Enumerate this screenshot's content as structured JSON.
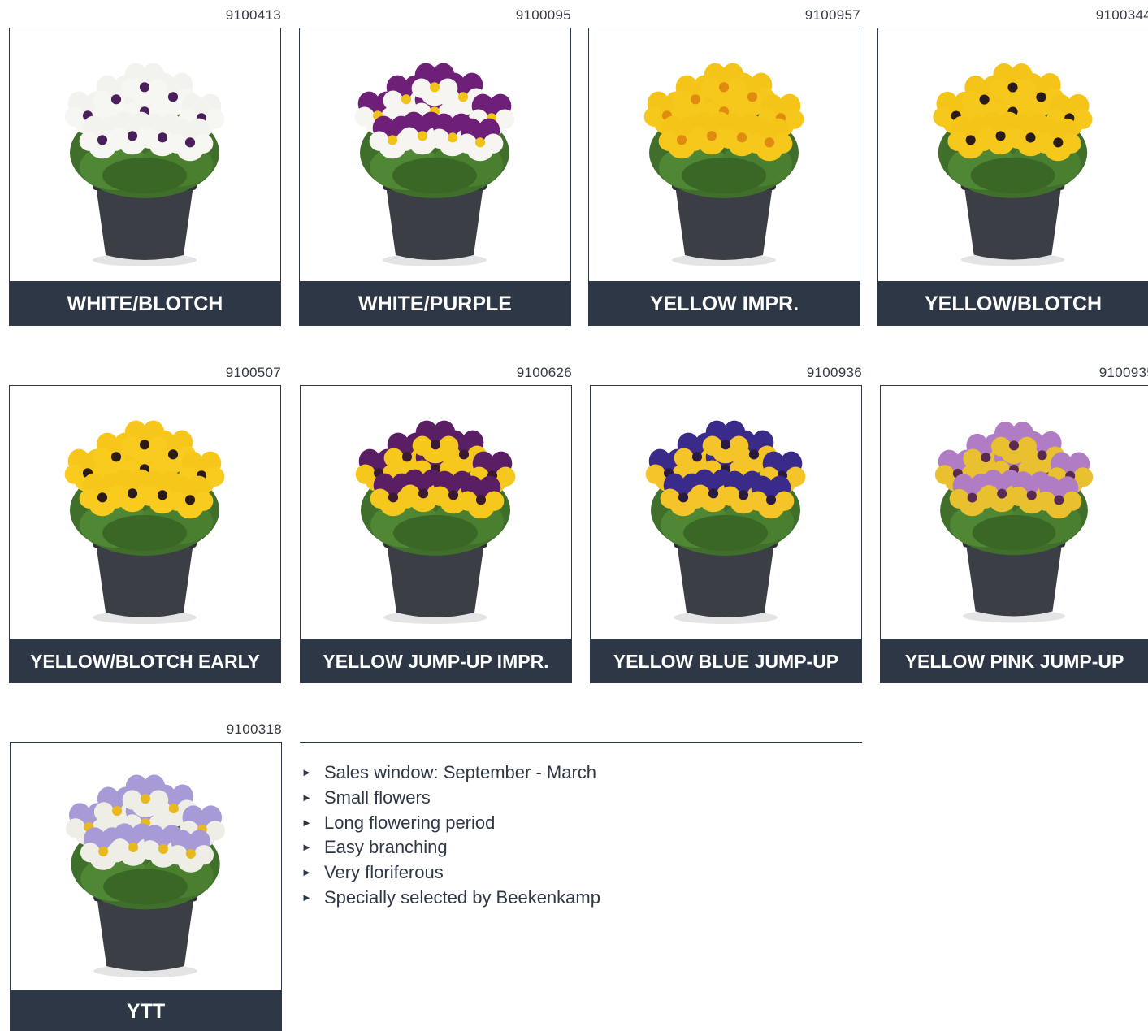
{
  "products": [
    {
      "code": "9100413",
      "label": "WHITE/BLOTCH",
      "image": "pansy-white-blotch-pot",
      "colors": {
        "petal": "#f6f6f2",
        "petal_top": "#f2f2ee",
        "center": "#4a1e5a"
      }
    },
    {
      "code": "9100095",
      "label": "WHITE/PURPLE",
      "image": "pansy-white-purple-pot",
      "colors": {
        "petal": "#f7f5f2",
        "petal_top": "#6e1f78",
        "center": "#f0c21a"
      }
    },
    {
      "code": "9100957",
      "label": "YELLOW IMPR.",
      "image": "pansy-yellow-pot",
      "colors": {
        "petal": "#f7c81c",
        "petal_top": "#f5c418",
        "center": "#e08a10"
      }
    },
    {
      "code": "9100344",
      "label": "YELLOW/BLOTCH",
      "image": "pansy-yellow-blotch-pot",
      "colors": {
        "petal": "#f7c81c",
        "petal_top": "#f5c418",
        "center": "#2a1a18"
      }
    },
    {
      "code": "9100507",
      "label": "YELLOW/BLOTCH EARLY",
      "image": "pansy-yellow-blotch-early-pot",
      "colors": {
        "petal": "#f8cb1e",
        "petal_top": "#f6c71a",
        "center": "#2a1a18"
      }
    },
    {
      "code": "9100626",
      "label": "YELLOW JUMP-UP IMPR.",
      "image": "pansy-yellow-jumpup-pot",
      "colors": {
        "petal": "#f6c81e",
        "petal_top": "#5a1e64",
        "center": "#3a1a30"
      }
    },
    {
      "code": "9100936",
      "label": "YELLOW BLUE JUMP-UP",
      "image": "pansy-yellow-blue-jumpup-pot",
      "colors": {
        "petal": "#f4c428",
        "petal_top": "#3a2a8a",
        "center": "#2a1a40"
      }
    },
    {
      "code": "9100935",
      "label": "YELLOW PINK JUMP-UP",
      "image": "pansy-yellow-pink-jumpup-pot",
      "colors": {
        "petal": "#e8c030",
        "petal_top": "#b07cc4",
        "center": "#5a2a50"
      }
    },
    {
      "code": "9100318",
      "label": "YTT",
      "image": "pansy-ytt-mix-pot",
      "colors": {
        "petal": "#efeee6",
        "petal_top": "#a79ad6",
        "center": "#e8b820"
      }
    }
  ],
  "features": [
    "Sales window: September - March",
    "Small flowers",
    "Long flowering period",
    "Easy branching",
    "Very floriferous",
    "Specially selected by Beekenkamp"
  ],
  "bullet_glyph": "►"
}
